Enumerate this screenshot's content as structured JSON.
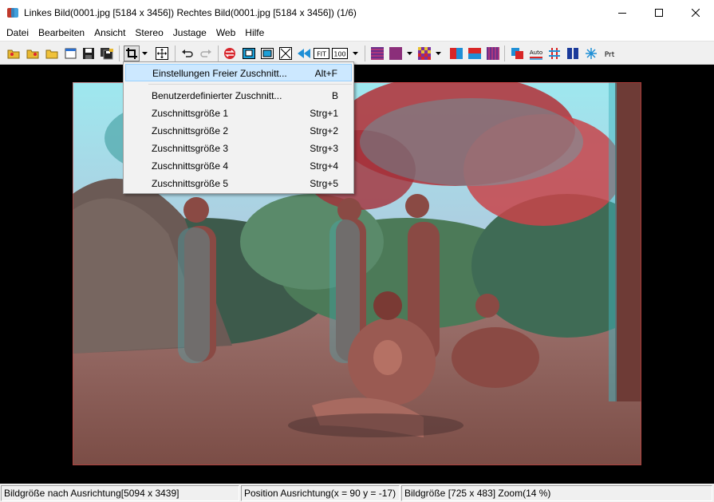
{
  "window": {
    "title": "Linkes Bild(0001.jpg [5184 x 3456]) Rechtes Bild(0001.jpg [5184 x 3456])  (1/6)"
  },
  "menubar": {
    "items": [
      "Datei",
      "Bearbeiten",
      "Ansicht",
      "Stereo",
      "Justage",
      "Web",
      "Hilfe"
    ]
  },
  "toolbar": {
    "fit_label": "FIT",
    "zoom100_label": "100",
    "auto_label": "Auto",
    "print_label": "Prt"
  },
  "dropdown": {
    "items": [
      {
        "label": "Einstellungen Freier Zuschnitt...",
        "shortcut": "Alt+F",
        "highlighted": true
      },
      {
        "label": "Benutzerdefinierter Zuschnitt...",
        "shortcut": "B"
      },
      {
        "label": "Zuschnittsgröße 1",
        "shortcut": "Strg+1"
      },
      {
        "label": "Zuschnittsgröße 2",
        "shortcut": "Strg+2"
      },
      {
        "label": "Zuschnittsgröße 3",
        "shortcut": "Strg+3"
      },
      {
        "label": "Zuschnittsgröße 4",
        "shortcut": "Strg+4"
      },
      {
        "label": "Zuschnittsgröße 5",
        "shortcut": "Strg+5"
      }
    ]
  },
  "statusbar": {
    "panel1": "Bildgröße nach Ausrichtung[5094 x 3439]",
    "panel2": "Position Ausrichtung(x = 90 y = -17)",
    "panel3": "Bildgröße [725 x 483]  Zoom(14 %)"
  },
  "colors": {
    "highlight": "#cce8ff",
    "highlight_border": "#99d1ff",
    "anaglyph_red": "#e23b3b",
    "anaglyph_cyan": "#3fd0d8"
  }
}
